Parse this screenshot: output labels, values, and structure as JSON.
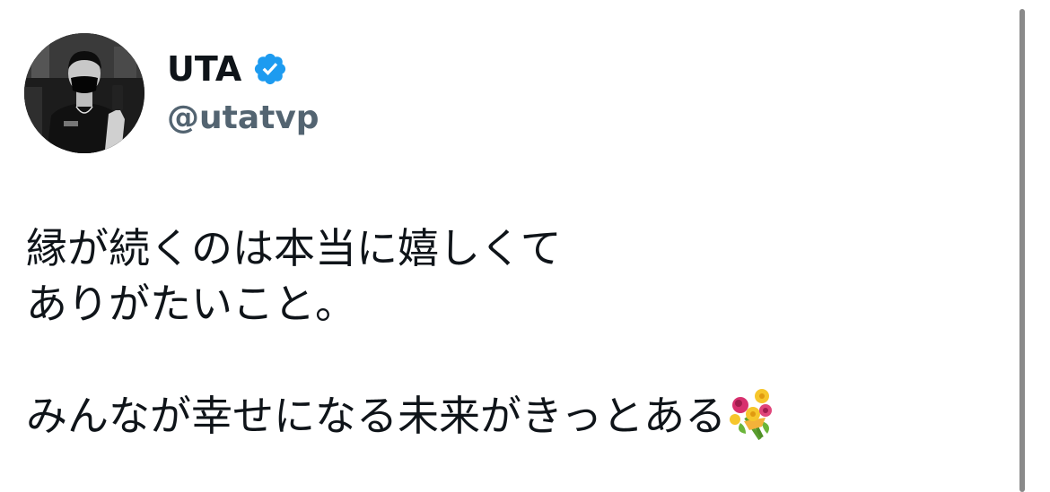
{
  "tweet": {
    "display_name": "UTA",
    "handle": "@utatvp",
    "verified": true,
    "text_lines": [
      "縁が続くのは本当に嬉しくて",
      "ありがたいこと。",
      "",
      "みんなが幸せになる未来がきっとある"
    ],
    "trailing_emoji": "bouquet-emoji"
  },
  "colors": {
    "verified_badge": "#1d9bf0",
    "handle_text": "#536471",
    "body_text": "#0f1419"
  },
  "icons": {
    "avatar": "avatar-photo",
    "verified": "verified-badge-icon",
    "emoji": "bouquet-emoji"
  }
}
